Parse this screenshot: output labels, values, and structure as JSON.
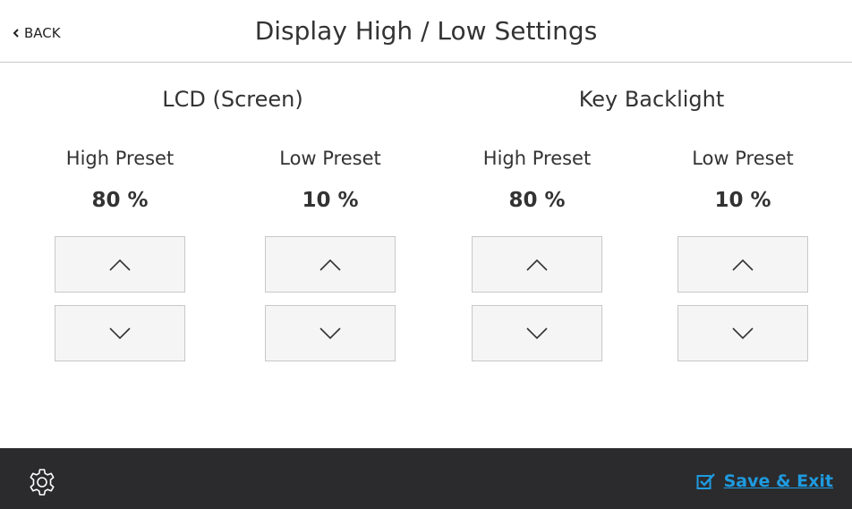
{
  "header": {
    "back_label": "BACK",
    "title": "Display High / Low Settings"
  },
  "sections": [
    {
      "title": "LCD (Screen)",
      "presets": [
        {
          "label": "High Preset",
          "value": "80 %"
        },
        {
          "label": "Low Preset",
          "value": "10 %"
        }
      ]
    },
    {
      "title": "Key Backlight",
      "presets": [
        {
          "label": "High Preset",
          "value": "80 %"
        },
        {
          "label": "Low Preset",
          "value": "10 %"
        }
      ]
    }
  ],
  "footer": {
    "settings_icon": "gear-icon",
    "save_label": "Save & Exit",
    "save_icon": "checkbox-check-icon"
  },
  "colors": {
    "footer_bg": "#2b2b2d",
    "accent": "#1e9be0",
    "button_bg": "#f5f5f5",
    "button_border": "#c8c8c8"
  }
}
